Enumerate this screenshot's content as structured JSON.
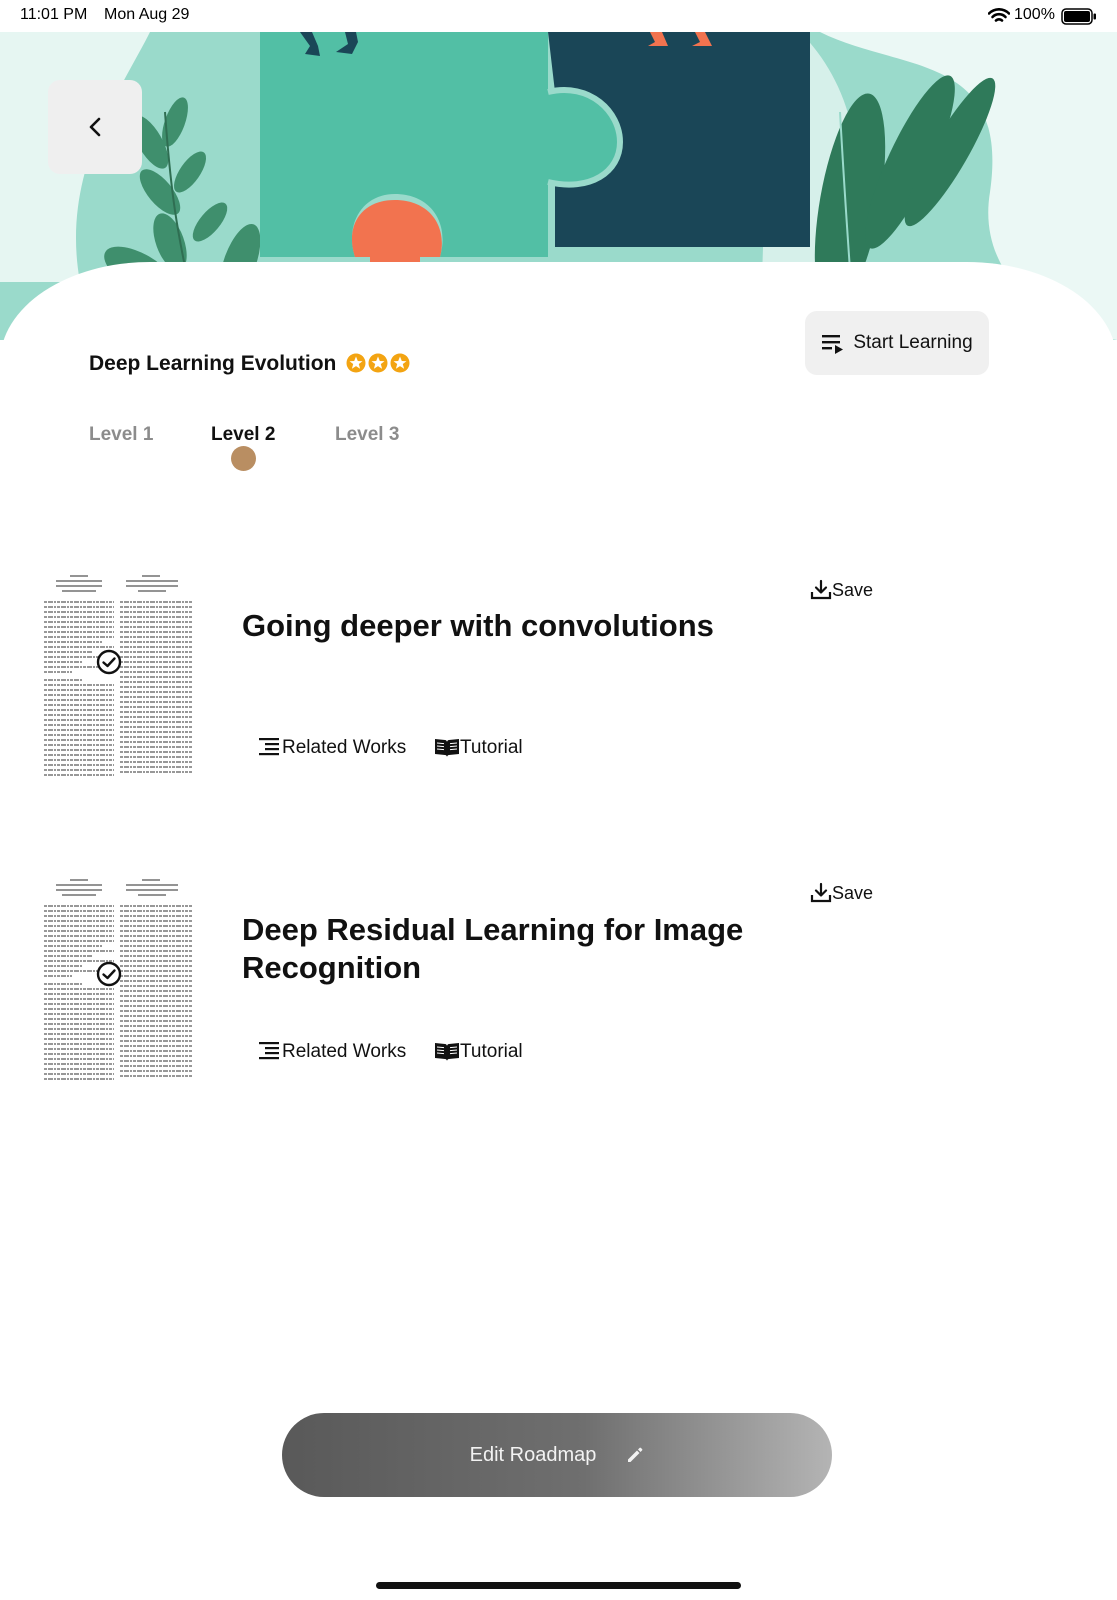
{
  "status_bar": {
    "time": "11:01 PM",
    "date": "Mon Aug 29",
    "battery": "100%"
  },
  "header": {
    "back_icon": "chevron-left-icon"
  },
  "roadmap": {
    "title": "Deep Learning Evolution",
    "stars": 3,
    "start_label": "Start Learning"
  },
  "levels": {
    "tabs": [
      "Level 1",
      "Level 2",
      "Level 3"
    ],
    "active": "Level 2"
  },
  "papers": [
    {
      "title": "Going deeper with convolutions",
      "save_label": "Save",
      "related_label": "Related Works",
      "tutorial_label": "Tutorial",
      "completed": true
    },
    {
      "title": "Deep Residual Learning for Image Recognition",
      "save_label": "Save",
      "related_label": "Related Works",
      "tutorial_label": "Tutorial",
      "completed": true
    }
  ],
  "footer": {
    "edit_label": "Edit Roadmap"
  },
  "colors": {
    "hero_bg": "#9adacb",
    "puzzle_green": "#52bfa5",
    "puzzle_navy": "#1a4657",
    "accent_orange": "#f2734f",
    "star": "#f3a412",
    "level_dot": "#b98e62"
  }
}
